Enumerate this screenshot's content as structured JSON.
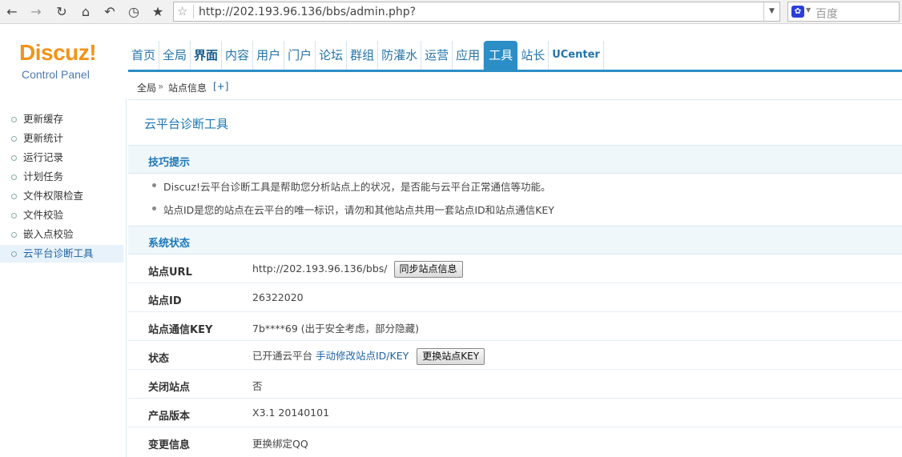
{
  "browser": {
    "url": "http://202.193.96.136/bbs/admin.php?",
    "search_placeholder": "百度"
  },
  "logo": {
    "brand": "Discuz!",
    "subtitle": "Control Panel"
  },
  "nav": {
    "items": [
      "首页",
      "全局",
      "界面",
      "内容",
      "用户",
      "门户",
      "论坛",
      "群组",
      "防灌水",
      "运营",
      "应用",
      "工具",
      "站长",
      "UCenter"
    ],
    "active": "工具"
  },
  "breadcrumb": {
    "root": "全局",
    "sep": "»",
    "current": "站点信息",
    "plus": "[+]"
  },
  "sidebar": {
    "items": [
      "更新缓存",
      "更新统计",
      "运行记录",
      "计划任务",
      "文件权限检查",
      "文件校验",
      "嵌入点校验",
      "云平台诊断工具"
    ],
    "active": "云平台诊断工具"
  },
  "main": {
    "title": "云平台诊断工具",
    "tips_header": "技巧提示",
    "tips": [
      "Discuz!云平台诊断工具是帮助您分析站点上的状况，是否能与云平台正常通信等功能。",
      "站点ID是您的站点在云平台的唯一标识，请勿和其他站点共用一套站点ID和站点通信KEY"
    ],
    "status_header": "系统状态",
    "rows": {
      "site_url": {
        "label": "站点URL",
        "value": "http://202.193.96.136/bbs/",
        "button": "同步站点信息"
      },
      "site_id": {
        "label": "站点ID",
        "value": "26322020"
      },
      "site_key": {
        "label": "站点通信KEY",
        "value": "7b****69 (出于安全考虑，部分隐藏)"
      },
      "status": {
        "label": "状态",
        "value": "已开通云平台",
        "link": "手动修改站点ID/KEY",
        "button": "更换站点KEY"
      },
      "close_site": {
        "label": "关闭站点",
        "value": "否"
      },
      "version": {
        "label": "产品版本",
        "value": "X3.1 20140101"
      },
      "change_info": {
        "label": "变更信息",
        "link": "更换绑定QQ"
      }
    }
  }
}
